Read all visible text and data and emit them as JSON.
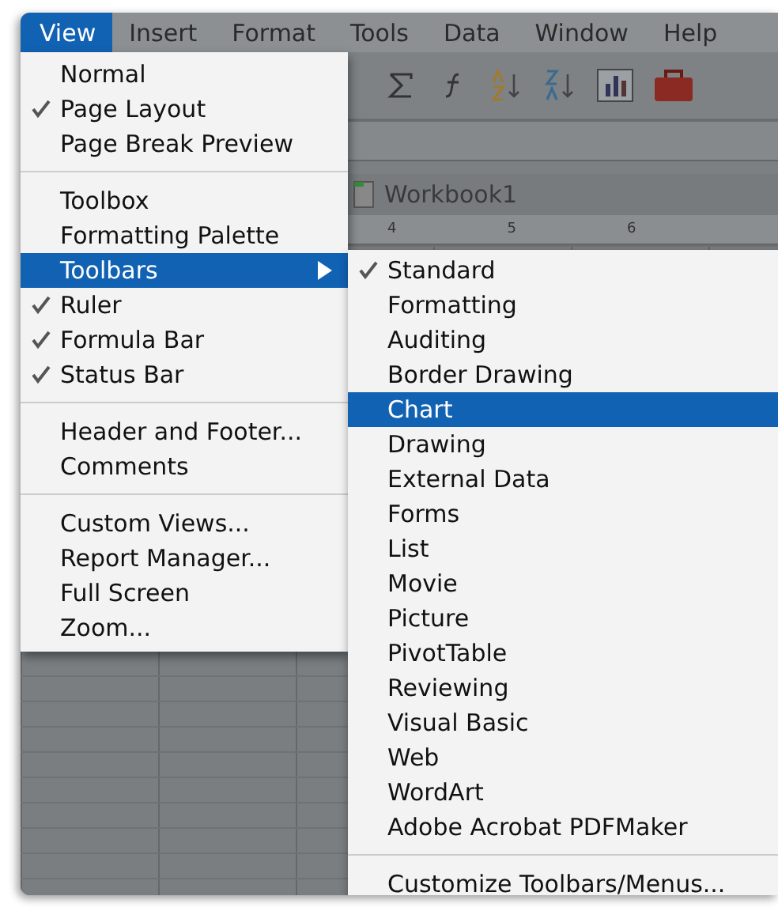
{
  "menu_bar": [
    {
      "label": "View",
      "selected": true
    },
    {
      "label": "Insert",
      "selected": false
    },
    {
      "label": "Format",
      "selected": false
    },
    {
      "label": "Tools",
      "selected": false
    },
    {
      "label": "Data",
      "selected": false
    },
    {
      "label": "Window",
      "selected": false
    },
    {
      "label": "Help",
      "selected": false
    }
  ],
  "workbook": {
    "title": "Workbook1"
  },
  "ruler": {
    "marks": [
      "4",
      "5",
      "6"
    ]
  },
  "view_menu": {
    "groups": [
      [
        {
          "label": "Normal",
          "checked": false,
          "selected": false,
          "has_submenu": false
        },
        {
          "label": "Page Layout",
          "checked": true,
          "selected": false,
          "has_submenu": false
        },
        {
          "label": "Page Break Preview",
          "checked": false,
          "selected": false,
          "has_submenu": false
        }
      ],
      [
        {
          "label": "Toolbox",
          "checked": false,
          "selected": false,
          "has_submenu": false
        },
        {
          "label": "Formatting Palette",
          "checked": false,
          "selected": false,
          "has_submenu": false
        },
        {
          "label": "Toolbars",
          "checked": false,
          "selected": true,
          "has_submenu": true
        },
        {
          "label": "Ruler",
          "checked": true,
          "selected": false,
          "has_submenu": false
        },
        {
          "label": "Formula Bar",
          "checked": true,
          "selected": false,
          "has_submenu": false
        },
        {
          "label": "Status Bar",
          "checked": true,
          "selected": false,
          "has_submenu": false
        }
      ],
      [
        {
          "label": "Header and Footer...",
          "checked": false,
          "selected": false,
          "has_submenu": false
        },
        {
          "label": "Comments",
          "checked": false,
          "selected": false,
          "has_submenu": false
        }
      ],
      [
        {
          "label": "Custom Views...",
          "checked": false,
          "selected": false,
          "has_submenu": false
        },
        {
          "label": "Report Manager...",
          "checked": false,
          "selected": false,
          "has_submenu": false
        },
        {
          "label": "Full Screen",
          "checked": false,
          "selected": false,
          "has_submenu": false
        },
        {
          "label": "Zoom...",
          "checked": false,
          "selected": false,
          "has_submenu": false
        }
      ]
    ]
  },
  "toolbars_menu": {
    "groups": [
      [
        {
          "label": "Standard",
          "checked": true,
          "selected": false
        },
        {
          "label": "Formatting",
          "checked": false,
          "selected": false
        },
        {
          "label": "Auditing",
          "checked": false,
          "selected": false
        },
        {
          "label": "Border Drawing",
          "checked": false,
          "selected": false
        },
        {
          "label": "Chart",
          "checked": false,
          "selected": true
        },
        {
          "label": "Drawing",
          "checked": false,
          "selected": false
        },
        {
          "label": "External Data",
          "checked": false,
          "selected": false
        },
        {
          "label": "Forms",
          "checked": false,
          "selected": false
        },
        {
          "label": "List",
          "checked": false,
          "selected": false
        },
        {
          "label": "Movie",
          "checked": false,
          "selected": false
        },
        {
          "label": "Picture",
          "checked": false,
          "selected": false
        },
        {
          "label": "PivotTable",
          "checked": false,
          "selected": false
        },
        {
          "label": "Reviewing",
          "checked": false,
          "selected": false
        },
        {
          "label": "Visual Basic",
          "checked": false,
          "selected": false
        },
        {
          "label": "Web",
          "checked": false,
          "selected": false
        },
        {
          "label": "WordArt",
          "checked": false,
          "selected": false
        },
        {
          "label": "Adobe Acrobat PDFMaker",
          "checked": false,
          "selected": false
        }
      ],
      [
        {
          "label": "Customize Toolbars/Menus...",
          "checked": false,
          "selected": false
        }
      ]
    ]
  }
}
